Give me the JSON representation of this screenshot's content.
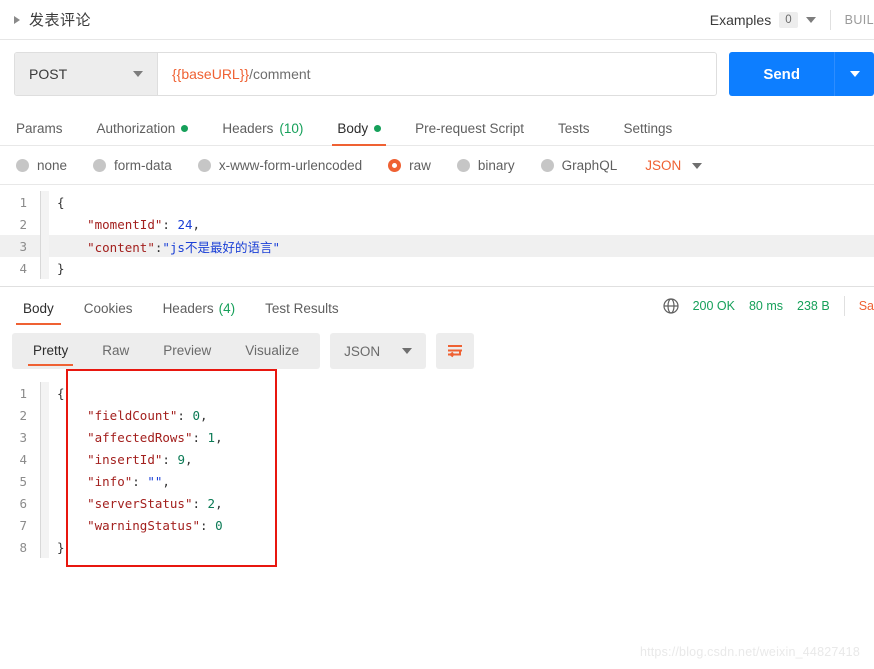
{
  "request_header": {
    "title": "发表评论",
    "expand_icon": "caret-right-icon",
    "examples_label": "Examples",
    "examples_count": "0",
    "examples_caret": "chevron-down-icon",
    "build_label": "BUIL"
  },
  "url_bar": {
    "method": "POST",
    "method_caret": "chevron-down-icon",
    "url_variable": "{{baseURL}}",
    "url_path": "/comment",
    "send_label": "Send",
    "send_caret": "chevron-down-icon",
    "accent_blue": "#0d7eff"
  },
  "request_tabs": [
    {
      "label": "Params",
      "badge": "",
      "dot": false,
      "active": false
    },
    {
      "label": "Authorization",
      "badge": "",
      "dot": true,
      "active": false
    },
    {
      "label": "Headers",
      "badge": "(10)",
      "dot": false,
      "active": false
    },
    {
      "label": "Body",
      "badge": "",
      "dot": true,
      "active": true
    },
    {
      "label": "Pre-request Script",
      "badge": "",
      "dot": false,
      "active": false
    },
    {
      "label": "Tests",
      "badge": "",
      "dot": false,
      "active": false
    },
    {
      "label": "Settings",
      "badge": "",
      "dot": false,
      "active": false
    }
  ],
  "body_types": {
    "options": [
      {
        "label": "none",
        "selected": false
      },
      {
        "label": "form-data",
        "selected": false
      },
      {
        "label": "x-www-form-urlencoded",
        "selected": false
      },
      {
        "label": "raw",
        "selected": true
      },
      {
        "label": "binary",
        "selected": false
      },
      {
        "label": "GraphQL",
        "selected": false
      }
    ],
    "format": "JSON",
    "format_caret": "chevron-down-icon",
    "accent_orange": "#ef6133"
  },
  "request_body": {
    "lines": [
      {
        "num": "1",
        "highlight": false,
        "tokens": [
          {
            "t": "{",
            "c": "p"
          }
        ]
      },
      {
        "num": "2",
        "highlight": false,
        "tokens": [
          {
            "t": "    ",
            "c": "p"
          },
          {
            "t": "\"momentId\"",
            "c": "k"
          },
          {
            "t": ": ",
            "c": "p"
          },
          {
            "t": "24",
            "c": "n"
          },
          {
            "t": ",",
            "c": "p"
          }
        ]
      },
      {
        "num": "3",
        "highlight": true,
        "tokens": [
          {
            "t": "    ",
            "c": "p"
          },
          {
            "t": "\"content\"",
            "c": "k"
          },
          {
            "t": ":",
            "c": "p"
          },
          {
            "t": "\"js不是最好的语言\"",
            "c": "s"
          }
        ]
      },
      {
        "num": "4",
        "highlight": false,
        "tokens": [
          {
            "t": "}",
            "c": "p"
          }
        ]
      }
    ]
  },
  "response_tabs": [
    {
      "label": "Body",
      "badge": "",
      "active": true
    },
    {
      "label": "Cookies",
      "badge": "",
      "active": false
    },
    {
      "label": "Headers",
      "badge": "(4)",
      "active": false
    },
    {
      "label": "Test Results",
      "badge": "",
      "active": false
    }
  ],
  "response_status": {
    "globe_icon": "globe-icon",
    "status": "200 OK",
    "time": "80 ms",
    "size": "238 B",
    "save_label": "Sa",
    "status_color": "#16a05a"
  },
  "response_toolbar": {
    "views": [
      {
        "label": "Pretty",
        "active": true
      },
      {
        "label": "Raw",
        "active": false
      },
      {
        "label": "Preview",
        "active": false
      },
      {
        "label": "Visualize",
        "active": false
      }
    ],
    "format": "JSON",
    "format_caret": "chevron-down-icon",
    "wrap_icon": "word-wrap-icon"
  },
  "response_body": {
    "lines": [
      {
        "num": "1",
        "tokens": [
          {
            "t": "{",
            "c": "p"
          }
        ]
      },
      {
        "num": "2",
        "tokens": [
          {
            "t": "    ",
            "c": "p"
          },
          {
            "t": "\"fieldCount\"",
            "c": "k"
          },
          {
            "t": ": ",
            "c": "p"
          },
          {
            "t": "0",
            "c": "n2"
          },
          {
            "t": ",",
            "c": "p"
          }
        ]
      },
      {
        "num": "3",
        "tokens": [
          {
            "t": "    ",
            "c": "p"
          },
          {
            "t": "\"affectedRows\"",
            "c": "k"
          },
          {
            "t": ": ",
            "c": "p"
          },
          {
            "t": "1",
            "c": "n2"
          },
          {
            "t": ",",
            "c": "p"
          }
        ]
      },
      {
        "num": "4",
        "tokens": [
          {
            "t": "    ",
            "c": "p"
          },
          {
            "t": "\"insertId\"",
            "c": "k"
          },
          {
            "t": ": ",
            "c": "p"
          },
          {
            "t": "9",
            "c": "n2"
          },
          {
            "t": ",",
            "c": "p"
          }
        ]
      },
      {
        "num": "5",
        "tokens": [
          {
            "t": "    ",
            "c": "p"
          },
          {
            "t": "\"info\"",
            "c": "k"
          },
          {
            "t": ": ",
            "c": "p"
          },
          {
            "t": "\"\"",
            "c": "s"
          },
          {
            "t": ",",
            "c": "p"
          }
        ]
      },
      {
        "num": "6",
        "tokens": [
          {
            "t": "    ",
            "c": "p"
          },
          {
            "t": "\"serverStatus\"",
            "c": "k"
          },
          {
            "t": ": ",
            "c": "p"
          },
          {
            "t": "2",
            "c": "n2"
          },
          {
            "t": ",",
            "c": "p"
          }
        ]
      },
      {
        "num": "7",
        "tokens": [
          {
            "t": "    ",
            "c": "p"
          },
          {
            "t": "\"warningStatus\"",
            "c": "k"
          },
          {
            "t": ": ",
            "c": "p"
          },
          {
            "t": "0",
            "c": "n2"
          }
        ]
      },
      {
        "num": "8",
        "tokens": [
          {
            "t": "}",
            "c": "p"
          }
        ]
      }
    ],
    "annotation_color": "#e8170f"
  },
  "watermark": "https://blog.csdn.net/weixin_44827418"
}
